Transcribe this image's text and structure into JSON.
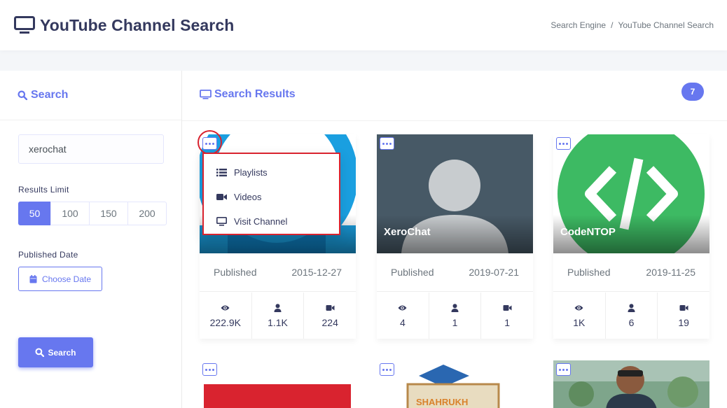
{
  "header": {
    "title": "YouTube Channel Search",
    "breadcrumb": [
      "Search Engine",
      "YouTube Channel Search"
    ]
  },
  "sidebar": {
    "heading": "Search",
    "search_value": "xerochat",
    "limit_label": "Results Limit",
    "limits": [
      "50",
      "100",
      "150",
      "200"
    ],
    "active_limit": "50",
    "date_label": "Published Date",
    "date_button": "Choose Date",
    "search_button": "Search"
  },
  "results": {
    "heading": "Search Results",
    "count": "7",
    "published_label": "Published",
    "cards": [
      {
        "name": "",
        "published": "2015-12-27",
        "views": "222.9K",
        "subscribers": "1.1K",
        "videos": "224"
      },
      {
        "name": "XeroChat",
        "published": "2019-07-21",
        "views": "4",
        "subscribers": "1",
        "videos": "1"
      },
      {
        "name": "CodeNTOP",
        "published": "2019-11-25",
        "views": "1K",
        "subscribers": "6",
        "videos": "19"
      }
    ]
  },
  "dropdown": {
    "items": [
      "Playlists",
      "Videos",
      "Visit Channel"
    ]
  },
  "colors": {
    "accent": "#6777ef",
    "highlight": "#d9232f"
  }
}
